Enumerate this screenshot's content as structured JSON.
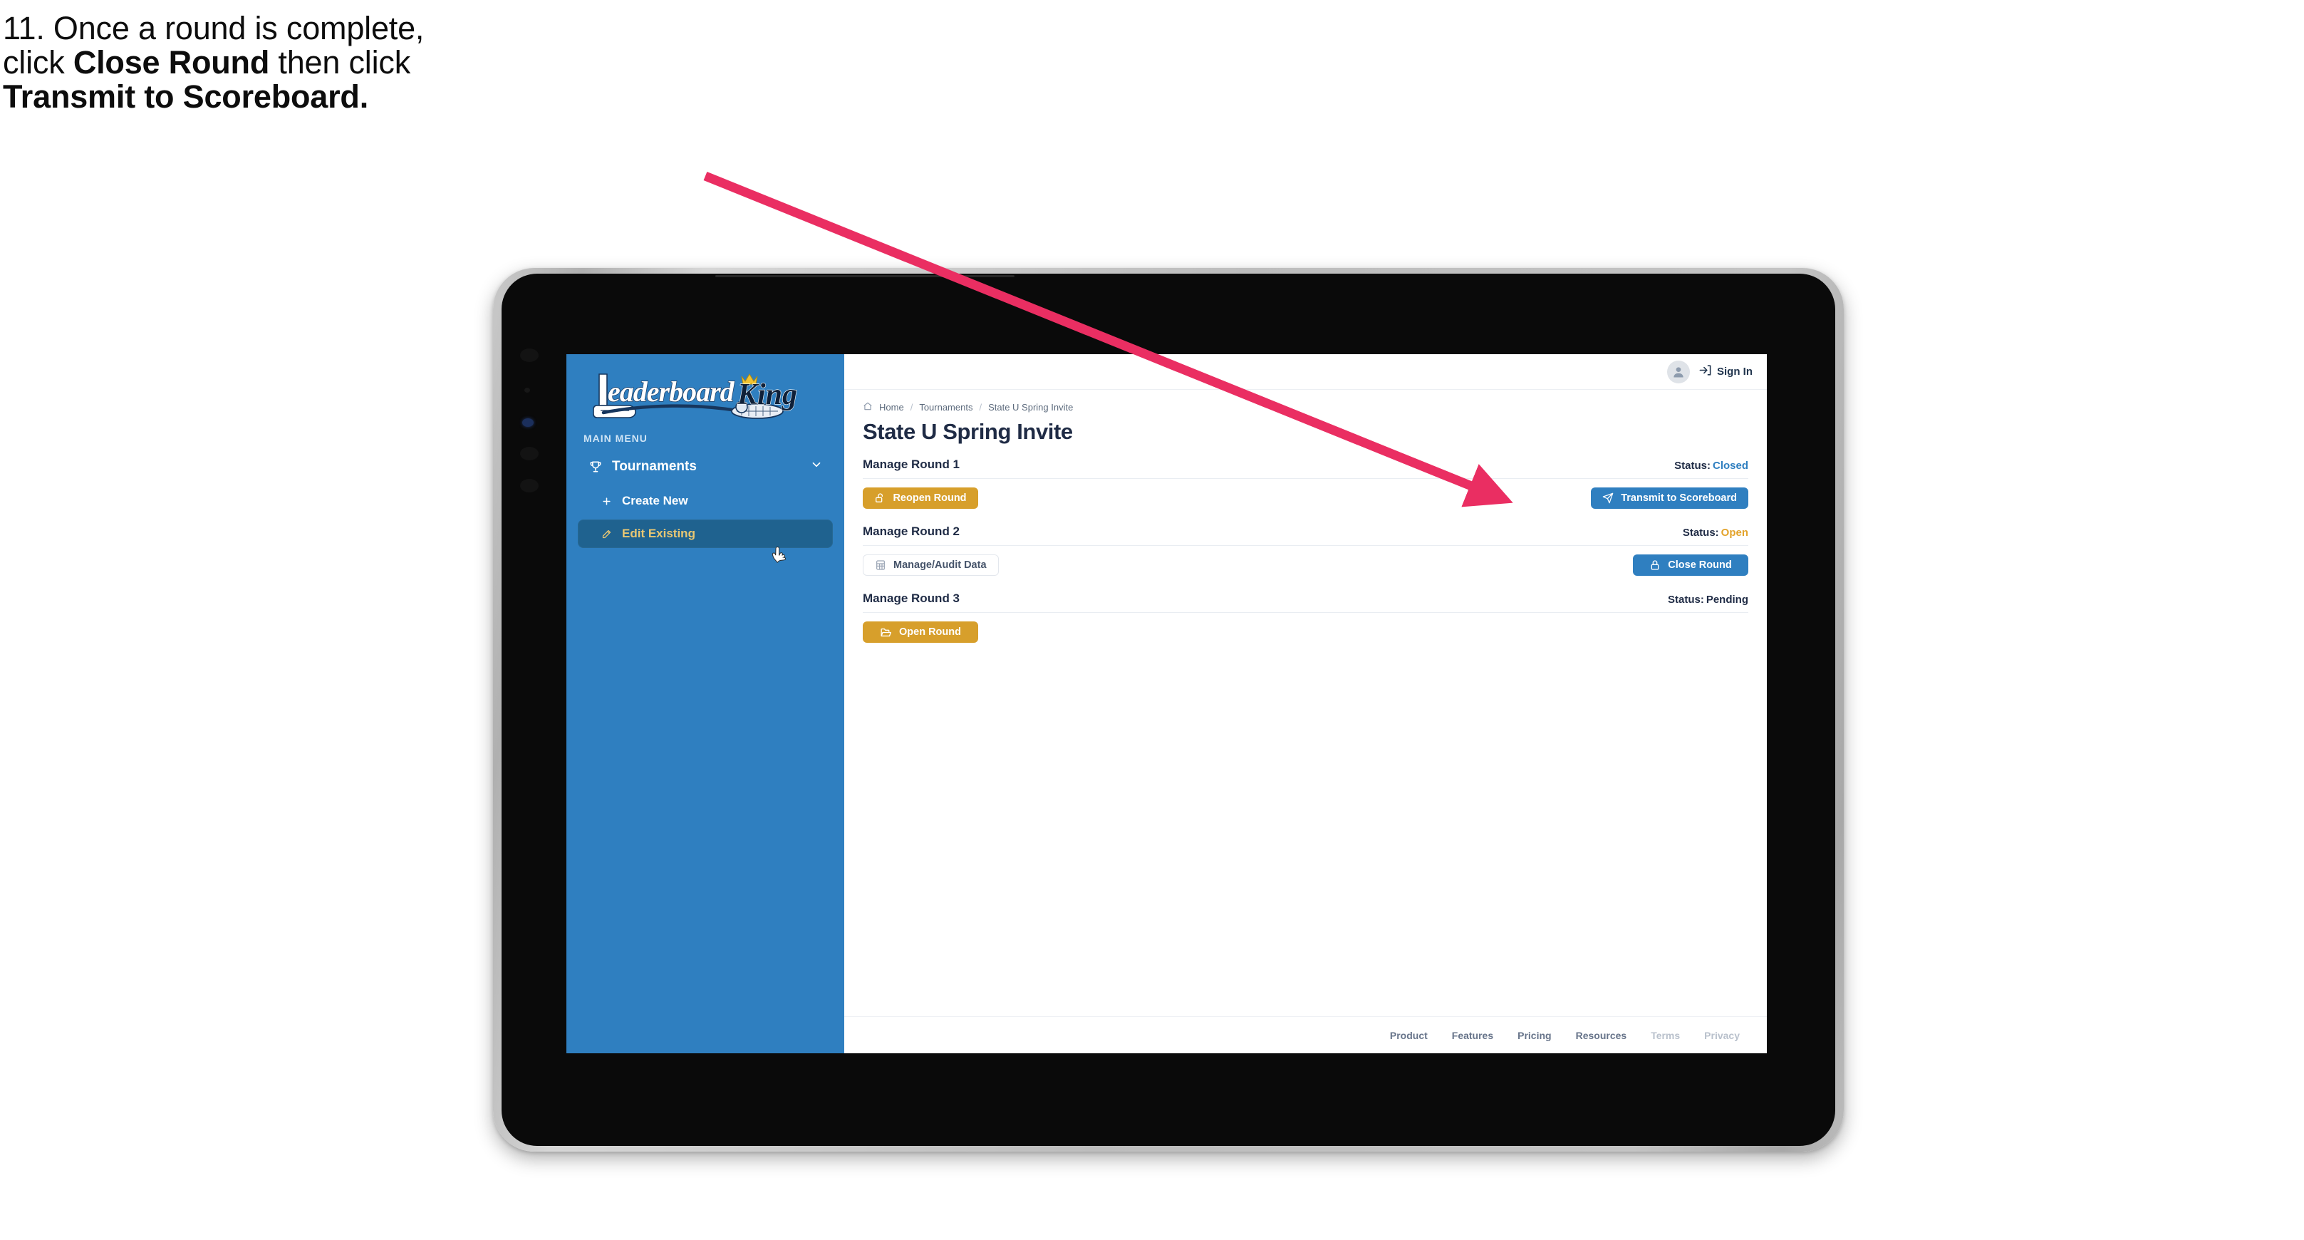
{
  "caption": {
    "line1_plain": "11. Once a round is complete,",
    "line2_pre": "click ",
    "line2_bold": "Close Round",
    "line2_post": " then click",
    "line3_bold": "Transmit to Scoreboard."
  },
  "annotation": {
    "arrow_color": "#ea2e62",
    "name": "pointer-arrow-to-transmit-button"
  },
  "app": {
    "sidebar": {
      "logo_primary": "Leaderboard",
      "logo_secondary": "King",
      "menu_label": "MAIN MENU",
      "items": [
        {
          "label": "Tournaments",
          "icon": "trophy-icon",
          "expanded": true,
          "chevron": "chevron-down-icon"
        },
        {
          "label": "Create New",
          "icon": "plus-icon",
          "active": false
        },
        {
          "label": "Edit Existing",
          "icon": "pencil-square-icon",
          "active": true
        }
      ],
      "bg_color": "#2f7fc0",
      "active_bg_color": "#1f628f",
      "active_text_color": "#e8c773"
    },
    "topbar": {
      "avatar_icon": "user-avatar-icon",
      "signin_icon": "sign-in-arrow-icon",
      "signin_label": "Sign In"
    },
    "breadcrumb": {
      "home_icon": "home-icon",
      "items": [
        "Home",
        "Tournaments",
        "State U Spring Invite"
      ],
      "separator": "/"
    },
    "page_title": "State U Spring Invite",
    "rounds": [
      {
        "name": "Manage Round 1",
        "status_label": "Status:",
        "status_value": "Closed",
        "status_color": "#2f7fc0",
        "left_button": {
          "label": "Reopen Round",
          "icon": "unlock-icon",
          "style": "gold"
        },
        "right_button": {
          "label": "Transmit to Scoreboard",
          "icon": "paper-plane-icon",
          "style": "blue"
        }
      },
      {
        "name": "Manage Round 2",
        "status_label": "Status:",
        "status_value": "Open",
        "status_color": "#e3a32b",
        "left_button": {
          "label": "Manage/Audit Data",
          "icon": "table-grid-icon",
          "style": "ghost"
        },
        "right_button": {
          "label": "Close Round",
          "icon": "lock-icon",
          "style": "blue"
        }
      },
      {
        "name": "Manage Round 3",
        "status_label": "Status:",
        "status_value": "Pending",
        "status_color": "#1f2b45",
        "left_button": {
          "label": "Open Round",
          "icon": "open-folder-icon",
          "style": "gold"
        },
        "right_button": null
      }
    ],
    "footer": {
      "links": [
        {
          "label": "Product",
          "dim": false
        },
        {
          "label": "Features",
          "dim": false
        },
        {
          "label": "Pricing",
          "dim": false
        },
        {
          "label": "Resources",
          "dim": false
        },
        {
          "label": "Terms",
          "dim": true
        },
        {
          "label": "Privacy",
          "dim": true
        }
      ]
    },
    "cursor": {
      "icon": "pointing-hand-cursor"
    }
  }
}
